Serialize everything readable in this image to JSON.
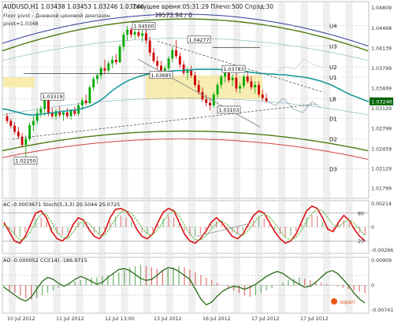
{
  "header": {
    "symbol_line": "AUDUSD,H1  1.03438 1.03453 1.03246 1.03246",
    "pivot_title": "Floor pivot - Дневной ценовой диапазон",
    "pivot_value": "pivot=1.0348",
    "server_time": "Текущее время:05:31:29 Плечо:500 Спрэд:30",
    "account": "39573.94 / 0"
  },
  "colors": {
    "background": "#ffffff",
    "bull_candle": "#00aa00",
    "bear_candle": "#cc0000",
    "ma_teal": "#1a9a9a",
    "envelope_green": "#4f7a10",
    "envelope_red": "#d04040",
    "envelope_blue": "#303a9a",
    "pivot_highlight": "#f6eaa4",
    "stoch_main": "#dd1111",
    "stoch_signal": "#66bb44",
    "cci": "#2a6a1a",
    "ao_up": "#1a8a1a",
    "ao_down": "#cc2222",
    "separator": "#e2e2e2",
    "price_tag": "#006400"
  },
  "chart_data": [
    {
      "type": "line",
      "title": "AUDUSD,H1",
      "ylim": [
        1.0163,
        1.0491
      ],
      "y_ticks": [
        "1.04809",
        "1.04468",
        "1.04139",
        "1.03799",
        "1.03469",
        "1.03129",
        "1.02799",
        "1.02459",
        "1.02129",
        "1.01799"
      ],
      "pivot_levels": [
        {
          "name": "U4",
          "value": 1.0451
        },
        {
          "name": "U3",
          "value": 1.0417
        },
        {
          "name": "U2",
          "value": 1.0382
        },
        {
          "name": "U1",
          "value": 1.0365
        },
        {
          "name": "LB",
          "value": 1.0329
        },
        {
          "name": "D1",
          "value": 1.0296
        },
        {
          "name": "D2",
          "value": 1.0262
        },
        {
          "name": "D3",
          "value": 1.0212
        }
      ],
      "current_price": "1.03246",
      "annotations": [
        {
          "label": "1.04500",
          "value": 1.045
        },
        {
          "label": "1.04277",
          "value": 1.0427
        },
        {
          "label": "1.03685",
          "value": 1.0368
        },
        {
          "label": "1.03783",
          "value": 1.0378
        },
        {
          "label": "1.03319",
          "value": 1.0332
        },
        {
          "label": "1.03103",
          "value": 1.031
        },
        {
          "label": "1.02250",
          "value": 1.0225
        }
      ],
      "candles": [
        [
          1.03,
          1.0305,
          1.0288,
          1.0292
        ],
        [
          1.0292,
          1.0296,
          1.028,
          1.0284
        ],
        [
          1.0284,
          1.029,
          1.027,
          1.0274
        ],
        [
          1.0274,
          1.0282,
          1.0262,
          1.0266
        ],
        [
          1.0266,
          1.0272,
          1.0248,
          1.0252
        ],
        [
          1.0252,
          1.0268,
          1.0225,
          1.0262
        ],
        [
          1.0262,
          1.029,
          1.0258,
          1.0285
        ],
        [
          1.0285,
          1.03,
          1.0275,
          1.0292
        ],
        [
          1.0292,
          1.0312,
          1.0286,
          1.0305
        ],
        [
          1.0305,
          1.0318,
          1.0298,
          1.0312
        ],
        [
          1.0312,
          1.0332,
          1.03,
          1.0326
        ],
        [
          1.0326,
          1.033,
          1.03,
          1.0306
        ],
        [
          1.0306,
          1.0314,
          1.0296,
          1.03
        ],
        [
          1.03,
          1.0312,
          1.0294,
          1.0308
        ],
        [
          1.0308,
          1.0316,
          1.0298,
          1.0302
        ],
        [
          1.0302,
          1.031,
          1.0292,
          1.0306
        ],
        [
          1.0306,
          1.0314,
          1.0296,
          1.03
        ],
        [
          1.03,
          1.0312,
          1.0294,
          1.0309
        ],
        [
          1.0309,
          1.0316,
          1.03,
          1.0304
        ],
        [
          1.0304,
          1.0322,
          1.03,
          1.0318
        ],
        [
          1.0318,
          1.033,
          1.031,
          1.0326
        ],
        [
          1.0326,
          1.0336,
          1.0318,
          1.0322
        ],
        [
          1.0322,
          1.0352,
          1.032,
          1.0348
        ],
        [
          1.0348,
          1.0366,
          1.0342,
          1.0362
        ],
        [
          1.0362,
          1.0372,
          1.0354,
          1.0368
        ],
        [
          1.0368,
          1.0384,
          1.0362,
          1.038
        ],
        [
          1.038,
          1.0394,
          1.037,
          1.0376
        ],
        [
          1.0376,
          1.0392,
          1.0372,
          1.0388
        ],
        [
          1.0388,
          1.04,
          1.038,
          1.0394
        ],
        [
          1.0394,
          1.0404,
          1.0386,
          1.039
        ],
        [
          1.039,
          1.042,
          1.0388,
          1.0416
        ],
        [
          1.0416,
          1.044,
          1.041,
          1.0436
        ],
        [
          1.0436,
          1.045,
          1.0426,
          1.0444
        ],
        [
          1.0444,
          1.0448,
          1.043,
          1.0436
        ],
        [
          1.0436,
          1.0446,
          1.0428,
          1.044
        ],
        [
          1.044,
          1.0448,
          1.043,
          1.0434
        ],
        [
          1.0434,
          1.0444,
          1.0424,
          1.0438
        ],
        [
          1.0438,
          1.0446,
          1.042,
          1.0426
        ],
        [
          1.0426,
          1.0432,
          1.04,
          1.0406
        ],
        [
          1.0406,
          1.0414,
          1.0388,
          1.0392
        ],
        [
          1.0392,
          1.04,
          1.0378,
          1.0384
        ],
        [
          1.0384,
          1.0392,
          1.037,
          1.0376
        ],
        [
          1.0376,
          1.0384,
          1.0368,
          1.038
        ],
        [
          1.038,
          1.04,
          1.0376,
          1.0396
        ],
        [
          1.0396,
          1.0416,
          1.039,
          1.041
        ],
        [
          1.041,
          1.0427,
          1.0396,
          1.04
        ],
        [
          1.04,
          1.0406,
          1.038,
          1.0386
        ],
        [
          1.0386,
          1.0392,
          1.0368,
          1.0372
        ],
        [
          1.0372,
          1.0382,
          1.036,
          1.0376
        ],
        [
          1.0376,
          1.0384,
          1.0364,
          1.0368
        ],
        [
          1.0368,
          1.0374,
          1.0348,
          1.0352
        ],
        [
          1.0352,
          1.036,
          1.0336,
          1.034
        ],
        [
          1.034,
          1.0348,
          1.0324,
          1.0328
        ],
        [
          1.0328,
          1.0336,
          1.0316,
          1.0322
        ],
        [
          1.0322,
          1.033,
          1.031,
          1.0318
        ],
        [
          1.0318,
          1.034,
          1.0314,
          1.0336
        ],
        [
          1.0336,
          1.0356,
          1.033,
          1.0352
        ],
        [
          1.0352,
          1.037,
          1.0346,
          1.0366
        ],
        [
          1.0366,
          1.0378,
          1.0356,
          1.0372
        ],
        [
          1.0372,
          1.0378,
          1.0356,
          1.036
        ],
        [
          1.036,
          1.037,
          1.035,
          1.0364
        ],
        [
          1.0364,
          1.0372,
          1.034,
          1.0346
        ],
        [
          1.0346,
          1.0356,
          1.0338,
          1.035
        ],
        [
          1.035,
          1.037,
          1.0346,
          1.0366
        ],
        [
          1.0366,
          1.0376,
          1.0354,
          1.0358
        ],
        [
          1.0358,
          1.0366,
          1.0344,
          1.0348
        ],
        [
          1.0348,
          1.0358,
          1.0338,
          1.0352
        ],
        [
          1.0352,
          1.0358,
          1.0332,
          1.0336
        ],
        [
          1.0336,
          1.0344,
          1.0326,
          1.033
        ],
        [
          1.033,
          1.0338,
          1.0322,
          1.0325
        ]
      ],
      "moving_average": [
        1.0312,
        1.0311,
        1.0309,
        1.0307,
        1.0305,
        1.0303,
        1.0302,
        1.0302,
        1.0303,
        1.0304,
        1.0305,
        1.0306,
        1.0307,
        1.0308,
        1.0309,
        1.031,
        1.0311,
        1.0313,
        1.0315,
        1.0318,
        1.0322,
        1.0327,
        1.0333,
        1.034,
        1.0346,
        1.0351,
        1.0356,
        1.036,
        1.0363,
        1.0366,
        1.0368,
        1.037,
        1.0371,
        1.0372,
        1.0373,
        1.0374,
        1.0375,
        1.0376,
        1.0376,
        1.0377,
        1.0377,
        1.0378,
        1.0378,
        1.0378,
        1.0378,
        1.0378,
        1.0378,
        1.0377,
        1.0377,
        1.0376,
        1.0376,
        1.0375,
        1.0374,
        1.0373,
        1.0372,
        1.0371,
        1.0371,
        1.037,
        1.037,
        1.0369,
        1.0369,
        1.0368,
        1.0367,
        1.0366,
        1.0365,
        1.0364,
        1.0362,
        1.036,
        1.0358,
        1.0355,
        1.0352,
        1.0348,
        1.0344,
        1.034,
        1.0336,
        1.0333,
        1.033,
        1.0327,
        1.0324
      ]
    },
    {
      "type": "line",
      "title": "AC -0.0003671 Stoch(5,3,3) 20.5044 25.0725",
      "ylim": [
        0,
        100
      ],
      "y_ticks": [
        "80",
        "20"
      ],
      "right_labels": [
        "0.00214",
        "0",
        "-0.00266"
      ],
      "series": [
        {
          "name": "Stoch(5,3,3)",
          "values": [
            60,
            40,
            20,
            15,
            30,
            55,
            80,
            85,
            70,
            40,
            25,
            20,
            30,
            55,
            70,
            65,
            45,
            30,
            25,
            40,
            70,
            88,
            90,
            85,
            70,
            45,
            30,
            25,
            35,
            60,
            82,
            90,
            85,
            60,
            35,
            20,
            15,
            25,
            40,
            60,
            70,
            60,
            45,
            30,
            25,
            35,
            55,
            75,
            85,
            80,
            60,
            40,
            25,
            15,
            20,
            35,
            60,
            85,
            95,
            90,
            70,
            45,
            40,
            60,
            75,
            65,
            45,
            30,
            20
          ]
        },
        {
          "name": "",
          "values": [
            55,
            48,
            35,
            22,
            25,
            40,
            62,
            78,
            78,
            60,
            40,
            28,
            25,
            38,
            55,
            63,
            58,
            45,
            33,
            32,
            48,
            68,
            82,
            86,
            80,
            65,
            48,
            35,
            33,
            45,
            62,
            78,
            85,
            75,
            55,
            35,
            23,
            22,
            30,
            45,
            58,
            63,
            56,
            45,
            35,
            32,
            42,
            58,
            72,
            78,
            72,
            58,
            42,
            28,
            22,
            28,
            42,
            62,
            80,
            88,
            85,
            70,
            55,
            50,
            60,
            65,
            58,
            45,
            32
          ]
        }
      ]
    },
    {
      "type": "bar",
      "title": "AO -0.000052 CCI(14) -186.9715",
      "right_labels": [
        "0.00909",
        "0",
        "-0.00741"
      ],
      "series": [
        {
          "name": "AO",
          "values": [
            -2,
            -4,
            -6,
            -8,
            -10,
            -11,
            -10,
            -8,
            -6,
            -4,
            -2,
            -1,
            1,
            3,
            4,
            5,
            6,
            6,
            7,
            8,
            9,
            10,
            12,
            14,
            15,
            16,
            15,
            14,
            13,
            12,
            13,
            14,
            15,
            14,
            12,
            10,
            8,
            6,
            4,
            2,
            0,
            -2,
            -4,
            -6,
            -8,
            -9,
            -8,
            -6,
            -4,
            -2,
            0,
            2,
            4,
            5,
            6,
            5,
            4,
            3,
            2,
            1,
            0,
            -1,
            -2,
            -3,
            -4,
            -5,
            -6
          ]
        },
        {
          "name": "CCI(14)",
          "values": [
            -20,
            -60,
            -100,
            -140,
            -160,
            -120,
            -40,
            40,
            80,
            60,
            20,
            -10,
            20,
            60,
            90,
            70,
            40,
            10,
            30,
            80,
            120,
            160,
            170,
            150,
            110,
            70,
            50,
            60,
            100,
            150,
            180,
            170,
            140,
            100,
            60,
            -40,
            -140,
            -200,
            -170,
            -110,
            -60,
            -30,
            -10,
            -20,
            -40,
            -20,
            10,
            50,
            90,
            120,
            140,
            120,
            80,
            40,
            10,
            -20,
            -10,
            30,
            80,
            130,
            150,
            120,
            60,
            0,
            -80,
            -140,
            -180
          ]
        }
      ]
    }
  ],
  "x_labels": [
    "10 Jul 2012",
    "11 Jul 2012",
    "12 Jul 13:00",
    "13 Jul 2012",
    "16 Jul 2012",
    "17 Jul 2012",
    "17 Jul 2012"
  ],
  "watermark": "alpari"
}
